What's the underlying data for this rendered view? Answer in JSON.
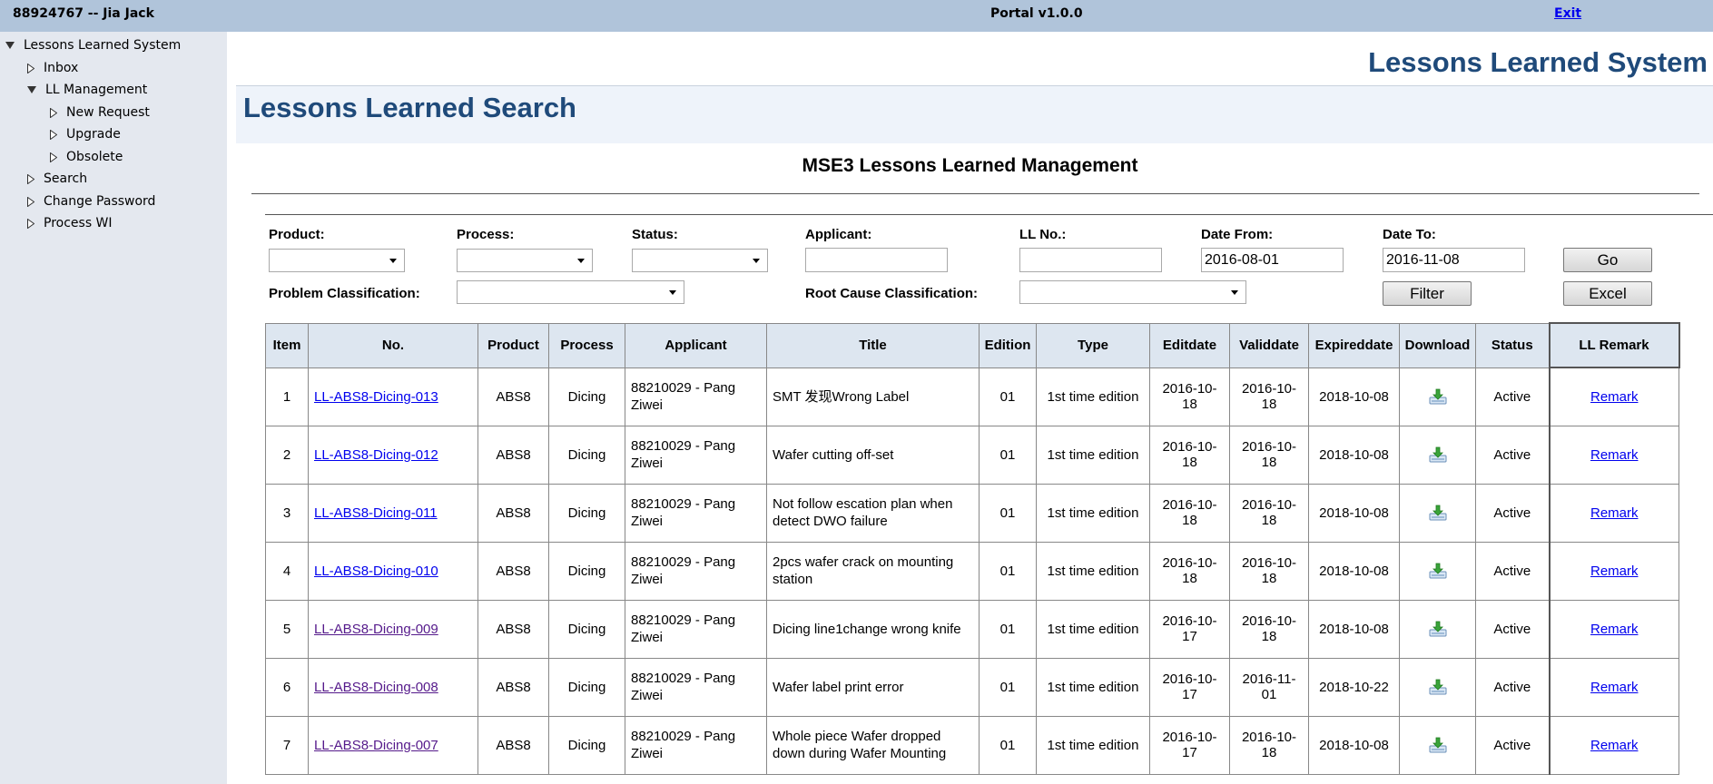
{
  "topbar": {
    "user": "88924767 -- Jia Jack",
    "portal": "Portal v1.0.0",
    "exit": "Exit"
  },
  "sidebar": {
    "root": "Lessons Learned System",
    "items": [
      {
        "label": "Inbox"
      },
      {
        "label": "LL Management"
      },
      {
        "label": "New Request"
      },
      {
        "label": "Upgrade"
      },
      {
        "label": "Obsolete"
      },
      {
        "label": "Search"
      },
      {
        "label": "Change Password"
      },
      {
        "label": "Process WI"
      }
    ]
  },
  "header": {
    "app_title": "Lessons Learned System",
    "page_title": "Lessons Learned Search",
    "section_title": "MSE3 Lessons Learned Management"
  },
  "filters": {
    "product_label": "Product:",
    "process_label": "Process:",
    "status_label": "Status:",
    "applicant_label": "Applicant:",
    "llno_label": "LL No.:",
    "date_from_label": "Date From:",
    "date_to_label": "Date To:",
    "problem_label": "Problem Classification:",
    "rootcause_label": "Root Cause Classification:",
    "applicant_value": "",
    "llno_value": "",
    "date_from": "2016-08-01",
    "date_to": "2016-11-08",
    "go": "Go",
    "filter": "Filter",
    "excel": "Excel"
  },
  "table": {
    "headers": [
      "Item",
      "No.",
      "Product",
      "Process",
      "Applicant",
      "Title",
      "Edition",
      "Type",
      "Editdate",
      "Validdate",
      "Expireddate",
      "Download",
      "Status",
      "LL Remark"
    ],
    "rows": [
      {
        "item": "1",
        "no": "LL-ABS8-Dicing-013",
        "product": "ABS8",
        "process": "Dicing",
        "applicant": "88210029 - Pang Ziwei",
        "title": "SMT 发现Wrong Label",
        "edition": "01",
        "type": "1st time edition",
        "editdate": "2016-10-18",
        "validdate": "2016-10-18",
        "expireddate": "2018-10-08",
        "status": "Active",
        "remark": "Remark"
      },
      {
        "item": "2",
        "no": "LL-ABS8-Dicing-012",
        "product": "ABS8",
        "process": "Dicing",
        "applicant": "88210029 - Pang Ziwei",
        "title": "Wafer cutting off-set",
        "edition": "01",
        "type": "1st time edition",
        "editdate": "2016-10-18",
        "validdate": "2016-10-18",
        "expireddate": "2018-10-08",
        "status": "Active",
        "remark": "Remark"
      },
      {
        "item": "3",
        "no": "LL-ABS8-Dicing-011",
        "product": "ABS8",
        "process": "Dicing",
        "applicant": "88210029 - Pang Ziwei",
        "title": "Not follow escation plan when detect DWO failure",
        "edition": "01",
        "type": "1st time edition",
        "editdate": "2016-10-18",
        "validdate": "2016-10-18",
        "expireddate": "2018-10-08",
        "status": "Active",
        "remark": "Remark"
      },
      {
        "item": "4",
        "no": "LL-ABS8-Dicing-010",
        "product": "ABS8",
        "process": "Dicing",
        "applicant": "88210029 - Pang Ziwei",
        "title": "2pcs wafer crack on mounting station",
        "edition": "01",
        "type": "1st time edition",
        "editdate": "2016-10-18",
        "validdate": "2016-10-18",
        "expireddate": "2018-10-08",
        "status": "Active",
        "remark": "Remark"
      },
      {
        "item": "5",
        "no": "LL-ABS8-Dicing-009",
        "product": "ABS8",
        "process": "Dicing",
        "applicant": "88210029 - Pang Ziwei",
        "title": "Dicing line1change wrong knife",
        "edition": "01",
        "type": "1st time edition",
        "editdate": "2016-10-17",
        "validdate": "2016-10-18",
        "expireddate": "2018-10-08",
        "status": "Active",
        "remark": "Remark"
      },
      {
        "item": "6",
        "no": "LL-ABS8-Dicing-008",
        "product": "ABS8",
        "process": "Dicing",
        "applicant": "88210029 - Pang Ziwei",
        "title": "Wafer label print error",
        "edition": "01",
        "type": "1st time edition",
        "editdate": "2016-10-17",
        "validdate": "2016-11-01",
        "expireddate": "2018-10-22",
        "status": "Active",
        "remark": "Remark"
      },
      {
        "item": "7",
        "no": "LL-ABS8-Dicing-007",
        "product": "ABS8",
        "process": "Dicing",
        "applicant": "88210029 - Pang Ziwei",
        "title": "Whole piece Wafer dropped down during Wafer Mounting",
        "edition": "01",
        "type": "1st time edition",
        "editdate": "2016-10-17",
        "validdate": "2016-10-18",
        "expireddate": "2018-10-08",
        "status": "Active",
        "remark": "Remark"
      }
    ]
  },
  "icons": {
    "download": "download-icon",
    "tree_expanded": "triangle-down-icon",
    "tree_collapsed": "triangle-right-icon"
  }
}
